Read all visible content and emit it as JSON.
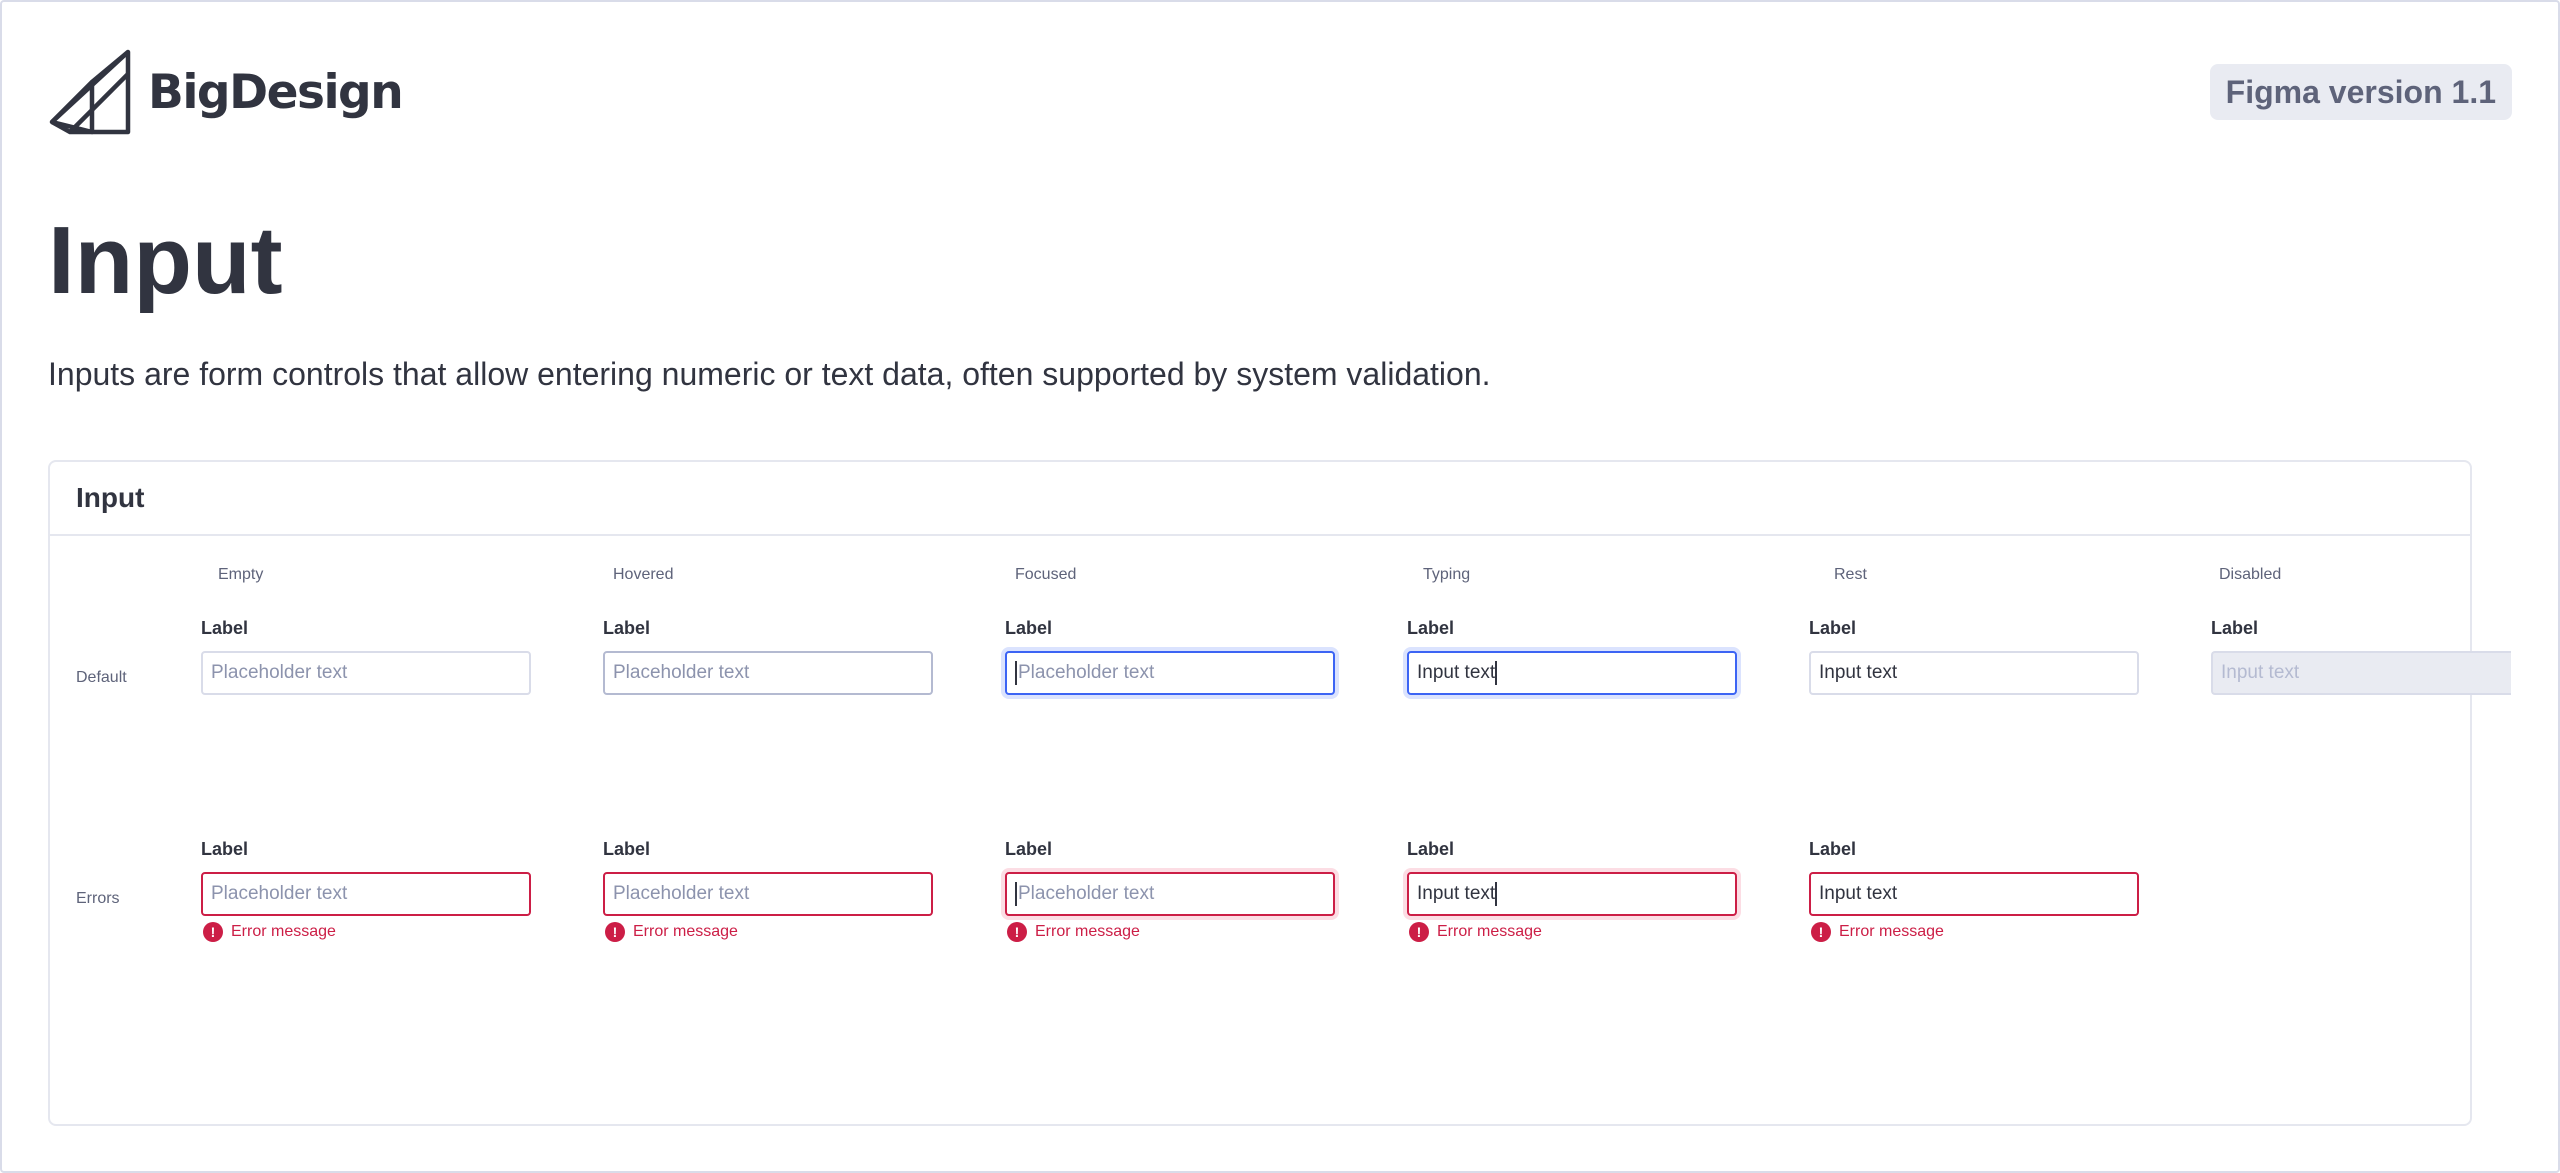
{
  "brand": {
    "name": "BigDesign",
    "logo_icon": "bigdesign-logo-icon"
  },
  "version_badge": "Figma version 1.1",
  "page": {
    "title": "Input",
    "description": "Inputs are form controls that allow entering numeric or text data, often supported by system validation."
  },
  "card": {
    "title": "Input",
    "columns": [
      "Empty",
      "Hovered",
      "Focused",
      "Typing",
      "Rest",
      "Disabled"
    ],
    "rows": [
      "Default",
      "Errors"
    ],
    "default_row": [
      {
        "label": "Label",
        "placeholder": "Placeholder text",
        "value": ""
      },
      {
        "label": "Label",
        "placeholder": "Placeholder text",
        "value": ""
      },
      {
        "label": "Label",
        "placeholder": "Placeholder text",
        "value": ""
      },
      {
        "label": "Label",
        "placeholder": "",
        "value": "Input text"
      },
      {
        "label": "Label",
        "placeholder": "",
        "value": "Input text"
      },
      {
        "label": "Label",
        "placeholder": "",
        "value": "Input text"
      }
    ],
    "error_row": [
      {
        "label": "Label",
        "placeholder": "Placeholder text",
        "value": "",
        "error": "Error message"
      },
      {
        "label": "Label",
        "placeholder": "Placeholder text",
        "value": "",
        "error": "Error message"
      },
      {
        "label": "Label",
        "placeholder": "Placeholder text",
        "value": "",
        "error": "Error message"
      },
      {
        "label": "Label",
        "placeholder": "",
        "value": "Input text",
        "error": "Error message"
      },
      {
        "label": "Label",
        "placeholder": "",
        "value": "Input text",
        "error": "Error message"
      }
    ],
    "error_icon": "exclamation-circle-icon",
    "error_glyph": "!"
  },
  "colors": {
    "text": "#313440",
    "muted": "#5e637a",
    "placeholder": "#8c93ad",
    "border": "#d9dce9",
    "focus": "#3c64f4",
    "error": "#cc1e46",
    "disabled_bg": "#e9ebf2"
  }
}
